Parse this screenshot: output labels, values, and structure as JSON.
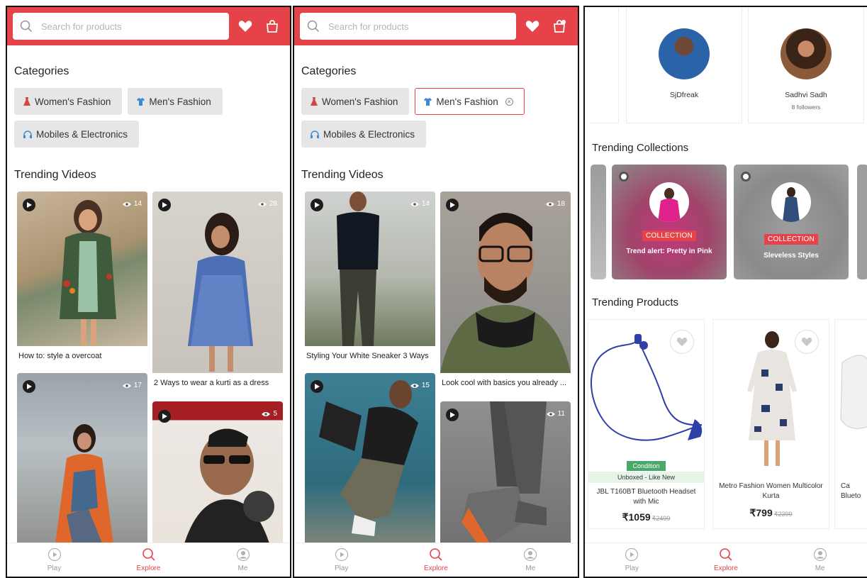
{
  "colors": {
    "accent": "#e5424a",
    "chip_bg": "#e6e6e6"
  },
  "header": {
    "search_placeholder": "Search for products",
    "icons": [
      "search-icon",
      "heart-icon",
      "shopping-bag-icon"
    ]
  },
  "categories": {
    "title": "Categories",
    "items": [
      {
        "label": "Women's Fashion",
        "icon": "dress-icon"
      },
      {
        "label": "Men's Fashion",
        "icon": "shirt-icon"
      },
      {
        "label": "Mobiles & Electronics",
        "icon": "headphones-icon"
      }
    ],
    "selected_in_second_screen": "Men's Fashion"
  },
  "trending_videos": {
    "title": "Trending Videos"
  },
  "screen1_videos": [
    {
      "caption": "How to: style a overcoat",
      "views": "14"
    },
    {
      "caption": "2 Ways to wear a kurti as a dress",
      "views": "28"
    },
    {
      "caption": "",
      "views": "17"
    },
    {
      "caption": "",
      "views": "5"
    }
  ],
  "screen2_videos": [
    {
      "caption": "Styling Your White Sneaker 3 Ways",
      "views": "14"
    },
    {
      "caption": "Look cool with basics you already ...",
      "views": "18"
    },
    {
      "caption": "",
      "views": "15"
    },
    {
      "caption": "",
      "views": "11"
    }
  ],
  "influencers": [
    {
      "name": "SjDfreak",
      "followers": ""
    },
    {
      "name": "Sadhvi Sadh",
      "followers": "8 followers"
    }
  ],
  "trending_collections": {
    "title": "Trending Collections",
    "items": [
      {
        "tag": "COLLECTION",
        "title": "Trend alert: Pretty in Pink"
      },
      {
        "tag": "COLLECTION",
        "title": "Sleveless Styles"
      }
    ]
  },
  "trending_products": {
    "title": "Trending Products",
    "items": [
      {
        "condition": "Condition",
        "condition_value": "Unboxed - Like New",
        "name": "JBL T160BT Bluetooth Headset with Mic",
        "price": "₹1059",
        "mrp": "₹2499"
      },
      {
        "name": "Metro Fashion Women Multicolor Kurta",
        "price": "₹799",
        "mrp": "₹2399"
      },
      {
        "name_partial": "Ca",
        "name_partial_2": "Blueto"
      }
    ]
  },
  "tabbar": [
    {
      "label": "Play",
      "icon": "play-circle-icon"
    },
    {
      "label": "Explore",
      "icon": "search-icon"
    },
    {
      "label": "Me",
      "icon": "user-icon"
    }
  ]
}
